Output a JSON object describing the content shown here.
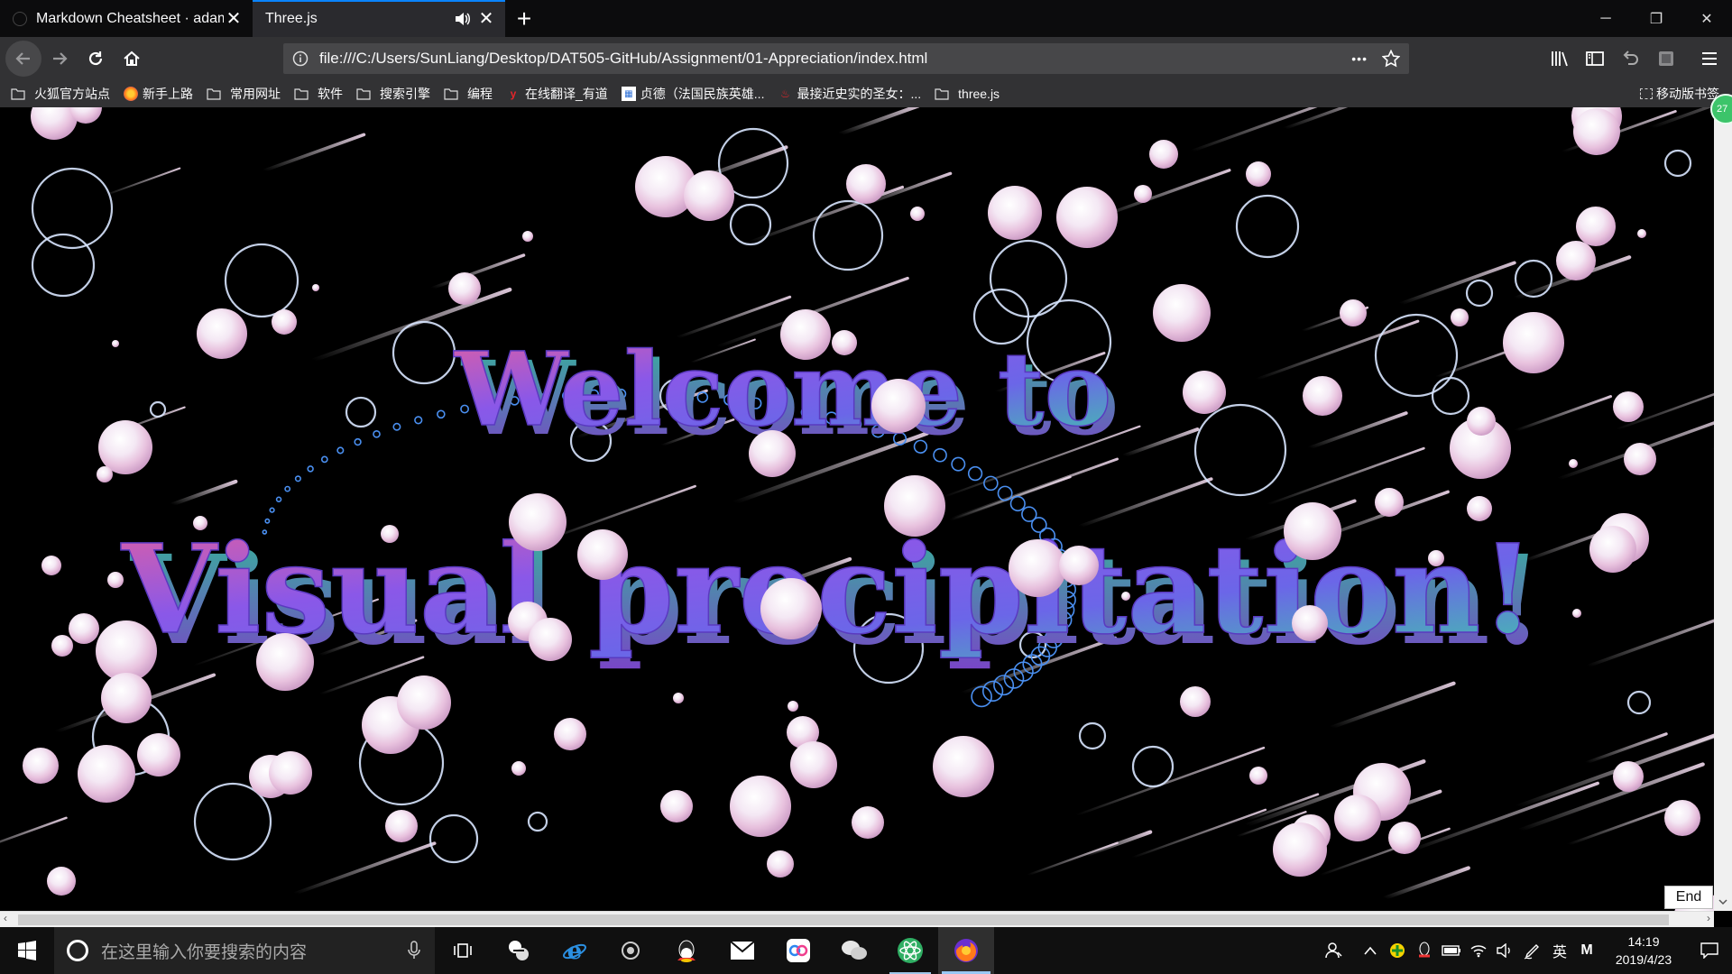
{
  "browser": {
    "tabs": [
      {
        "title": "Markdown Cheatsheet · adam-",
        "active": false
      },
      {
        "title": "Three.js",
        "active": true
      }
    ],
    "new_tab_label": "+",
    "url": "file:///C:/Users/SunLiang/Desktop/DAT505-GitHub/Assignment/01-Appreciation/index.html",
    "more_label": "•••",
    "bookmarks": [
      {
        "label": "火狐官方站点",
        "icon": "folder-icon"
      },
      {
        "label": "新手上路",
        "icon": "firefox-icon"
      },
      {
        "label": "常用网址",
        "icon": "folder-icon"
      },
      {
        "label": "软件",
        "icon": "folder-icon"
      },
      {
        "label": "搜索引擎",
        "icon": "folder-icon"
      },
      {
        "label": "编程",
        "icon": "folder-icon"
      },
      {
        "label": "在线翻译_有道",
        "icon": "youdao-icon"
      },
      {
        "label": "贞德（法国民族英雄...",
        "icon": "site-icon"
      },
      {
        "label": "最接近史实的圣女：...",
        "icon": "weibo-icon"
      },
      {
        "label": "three.js",
        "icon": "folder-icon"
      }
    ],
    "mobile_bookmarks": "移动版书签",
    "badge": "27"
  },
  "scene": {
    "line1": "Welcome to",
    "line2": "Visual precipitation!",
    "end_label": "End"
  },
  "taskbar": {
    "search_placeholder": "在这里输入你要搜索的内容",
    "ime": "英",
    "ime_mode": "M",
    "time": "14:19",
    "date": "2019/4/23"
  }
}
